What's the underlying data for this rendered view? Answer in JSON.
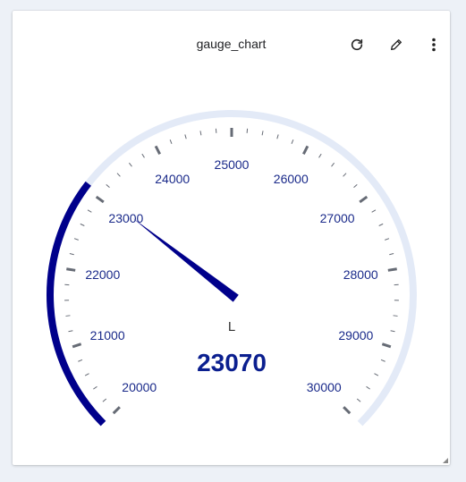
{
  "widget": {
    "title": "gauge_chart",
    "icons": {
      "refresh": "refresh-icon",
      "edit": "pencil-icon",
      "menu": "more-vertical-icon"
    }
  },
  "chart_data": {
    "type": "gauge",
    "min": 20000,
    "max": 30000,
    "value": 23070,
    "value_label": "23070",
    "unit": "L",
    "major_ticks": [
      20000,
      21000,
      22000,
      23000,
      24000,
      25000,
      26000,
      27000,
      28000,
      29000,
      30000
    ],
    "major_labels": [
      "20000",
      "21000",
      "22000",
      "23000",
      "24000",
      "25000",
      "26000",
      "27000",
      "28000",
      "29000",
      "30000"
    ],
    "minor_divisions": 5,
    "colors": {
      "progress": "#00008b",
      "track": "#e3eaf7",
      "needle": "#00008b",
      "ticks": "#666b75",
      "labels": "#1a2a8a"
    }
  }
}
